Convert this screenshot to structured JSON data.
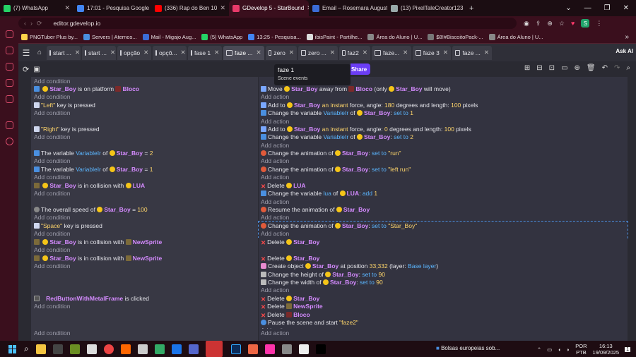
{
  "browser": {
    "tabs": [
      {
        "label": "(7) WhatsApp",
        "color": "#25d366",
        "w": 104
      },
      {
        "label": "17:01 - Pesquisa Google",
        "color": "#4285f4",
        "w": 110
      },
      {
        "label": "(336) Rap do Ben 10",
        "color": "#ff0000",
        "w": 110
      },
      {
        "label": "GDevelop 5 - StarBound",
        "color": "#e83a6a",
        "w": 113,
        "active": true
      },
      {
        "label": "Email – Rosemara August",
        "color": "#3b6cd6",
        "w": 111
      },
      {
        "label": "(13) PixelTaleCreator123",
        "color": "#9aa",
        "w": 112
      }
    ],
    "new_tab": "+",
    "window_controls": [
      "⌄",
      "—",
      "❐",
      "✕"
    ],
    "url": "editor.gdevelop.io",
    "profile_initial": "S",
    "bookmarks": [
      {
        "label": "PNGTuber Plus by...",
        "color": "#ffd24a"
      },
      {
        "label": "Servers | Aternos...",
        "color": "#4a8fe0"
      },
      {
        "label": "Mail - Migajo Aug...",
        "color": "#3b6cd6"
      },
      {
        "label": "(5) WhatsApp",
        "color": "#25d366"
      },
      {
        "label": "13:25 - Pesquisa...",
        "color": "#4285f4"
      },
      {
        "label": "ibisPaint - Partilhe...",
        "color": "#ddd"
      },
      {
        "label": "Área do Aluno | U...",
        "color": "#888"
      },
      {
        "label": "$8!#BiscoitoPack-...",
        "color": "#777"
      },
      {
        "label": "Área do Aluno | U...",
        "color": "#888"
      }
    ]
  },
  "project_tabs": [
    {
      "label": "start ...",
      "w": 48
    },
    {
      "label": "start ...",
      "w": 48
    },
    {
      "label": "opção",
      "w": 48
    },
    {
      "label": "opçõ...",
      "w": 48
    },
    {
      "label": "fase 1",
      "w": 48
    },
    {
      "label": "faze ...",
      "w": 58,
      "active": true
    },
    {
      "label": "zero",
      "w": 44
    },
    {
      "label": "zero ...",
      "w": 56
    },
    {
      "label": "faz2",
      "w": 44
    },
    {
      "label": "faze...",
      "w": 56
    },
    {
      "label": "faze 3",
      "w": 54
    },
    {
      "label": "faze ...",
      "w": 56
    }
  ],
  "ask_ai": "Ask AI",
  "share": "Share",
  "tooltip": {
    "title": "faze 1",
    "subtitle": "Scene events"
  },
  "events": {
    "add_condition": "Add condition",
    "add_action": "Add action",
    "top_partial_condition": "Add condition"
  },
  "taskbar": {
    "news": "Bolsas europeias sob...",
    "lang1": "POR",
    "lang2": "PTB",
    "time": "16:13",
    "date": "19/09/2025",
    "notif": "1"
  }
}
